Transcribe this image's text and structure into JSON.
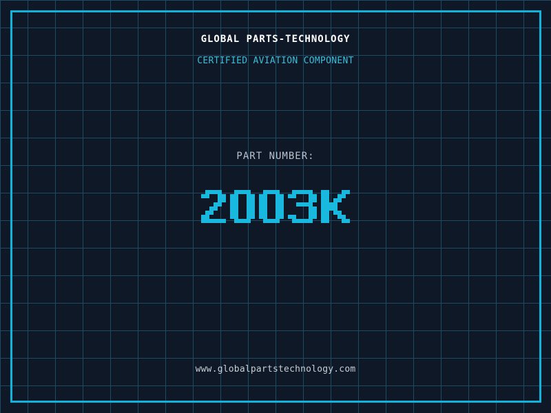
{
  "header": {
    "title": "GLOBAL PARTS-TECHNOLOGY",
    "subtitle": "CERTIFIED AVIATION COMPONENT"
  },
  "part": {
    "label": "PART NUMBER:",
    "value": "2003K"
  },
  "footer": {
    "url": "www.globalpartstechnology.com"
  },
  "colors": {
    "background": "#0f1827",
    "grid_line": "#1d4b63",
    "frame": "#12b3da",
    "accent": "#19b8de",
    "title": "#ffffff",
    "subtitle": "#3dbdd9",
    "muted": "#b9c2cc",
    "footer": "#c7cdd5"
  }
}
